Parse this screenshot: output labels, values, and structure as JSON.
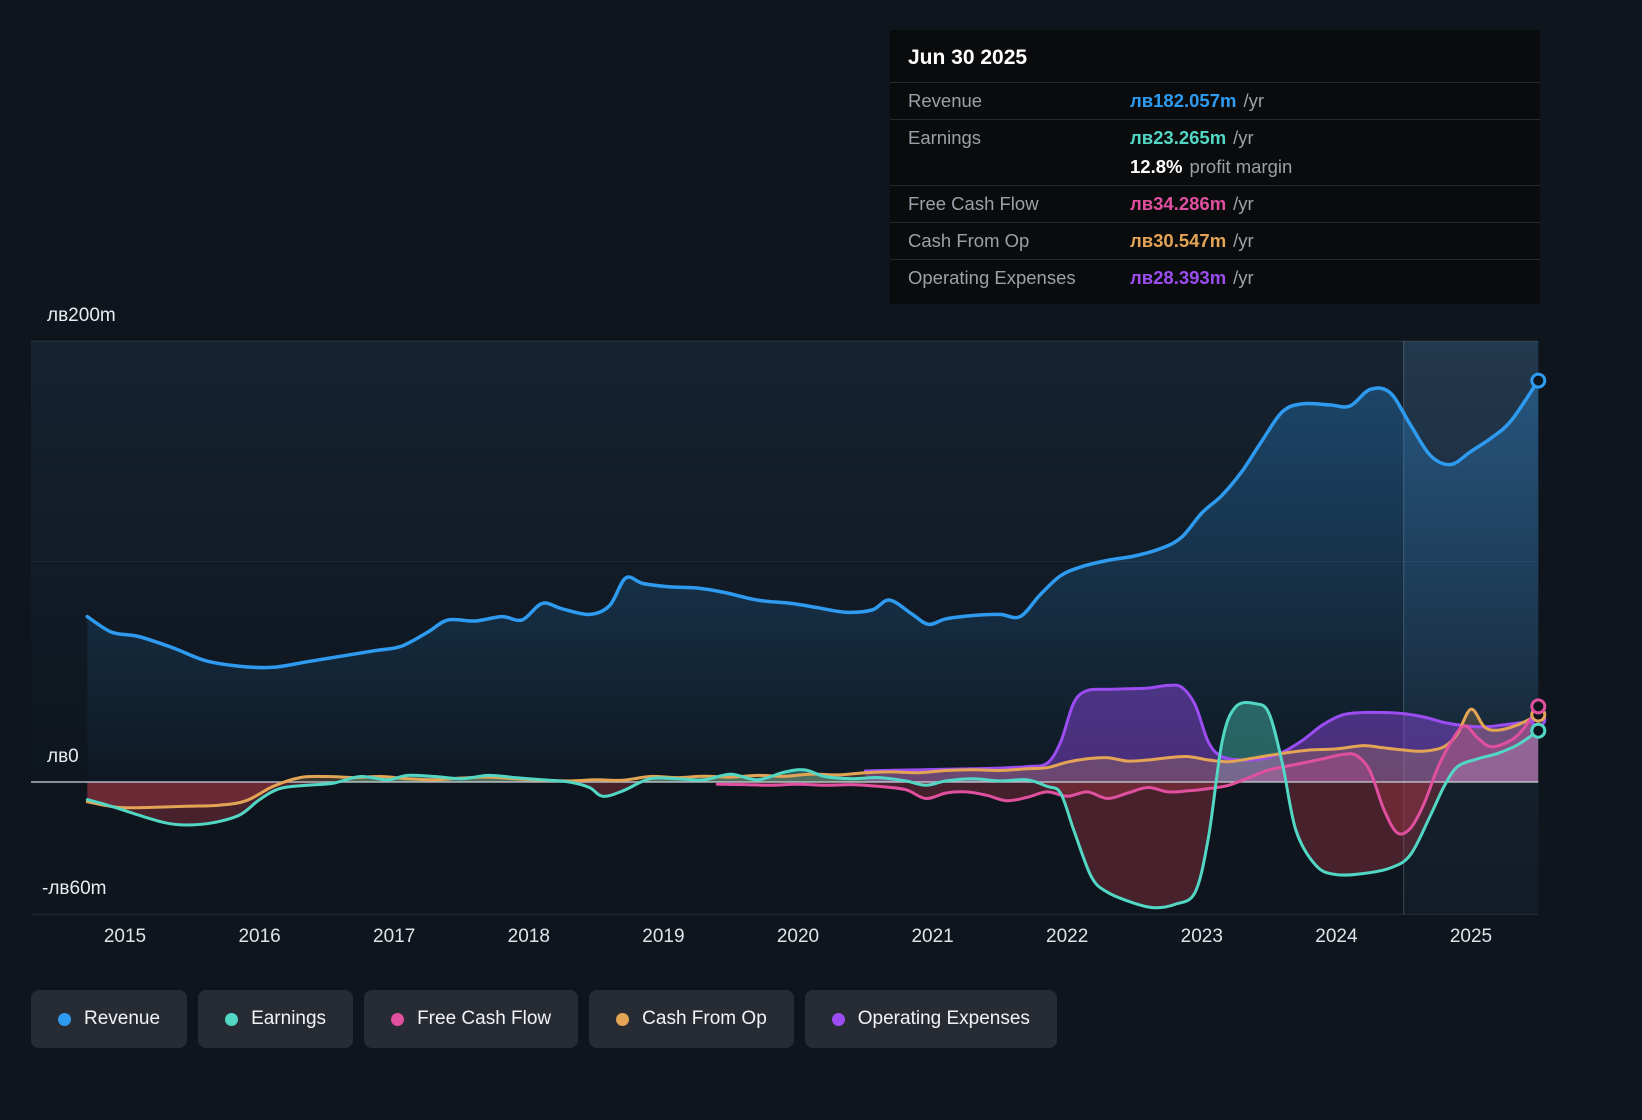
{
  "tooltip": {
    "date": "Jun 30 2025",
    "rows": [
      {
        "key": "revenue",
        "label": "Revenue",
        "value": "лв182.057m",
        "suffix": "/yr"
      },
      {
        "key": "earnings",
        "label": "Earnings",
        "value": "лв23.265m",
        "suffix": "/yr"
      },
      {
        "key": "fcf",
        "label": "Free Cash Flow",
        "value": "лв34.286m",
        "suffix": "/yr"
      },
      {
        "key": "cashop",
        "label": "Cash From Op",
        "value": "лв30.547m",
        "suffix": "/yr"
      },
      {
        "key": "opex",
        "label": "Operating Expenses",
        "value": "лв28.393m",
        "suffix": "/yr"
      }
    ],
    "margin": {
      "value": "12.8%",
      "suffix": "profit margin"
    }
  },
  "legend": {
    "items": [
      {
        "key": "revenue",
        "label": "Revenue"
      },
      {
        "key": "earnings",
        "label": "Earnings"
      },
      {
        "key": "fcf",
        "label": "Free Cash Flow"
      },
      {
        "key": "cashop",
        "label": "Cash From Op"
      },
      {
        "key": "opex",
        "label": "Operating Expenses"
      }
    ]
  },
  "chart_data": {
    "type": "line",
    "title": "",
    "currency_unit": "лв (millions)",
    "x_ticks": [
      "2015",
      "2016",
      "2017",
      "2018",
      "2019",
      "2020",
      "2021",
      "2022",
      "2023",
      "2024",
      "2025"
    ],
    "y_ticks": [
      {
        "label": "лв200m",
        "value": 200
      },
      {
        "label": "лв0",
        "value": 0
      },
      {
        "label": "-лв60m",
        "value": -60
      }
    ],
    "grid_values": [
      200,
      100,
      0,
      -60
    ],
    "xlim": [
      2014.55,
      2025.55
    ],
    "ylim": [
      -72,
      210
    ],
    "highlight_start_x": 2024.5,
    "negative_fill": "#c13a4e",
    "legend_position": "bottom",
    "series": [
      {
        "name": "Revenue",
        "key": "revenue",
        "color": "#2e9bf0",
        "points": [
          [
            2014.72,
            75
          ],
          [
            2014.9,
            68
          ],
          [
            2015.1,
            66
          ],
          [
            2015.35,
            61
          ],
          [
            2015.6,
            55
          ],
          [
            2015.85,
            52.5
          ],
          [
            2016.1,
            52
          ],
          [
            2016.35,
            54.5
          ],
          [
            2016.6,
            57
          ],
          [
            2016.85,
            59.5
          ],
          [
            2017.05,
            61.5
          ],
          [
            2017.25,
            68
          ],
          [
            2017.4,
            73.5
          ],
          [
            2017.6,
            73
          ],
          [
            2017.8,
            75
          ],
          [
            2017.95,
            73.5
          ],
          [
            2018.1,
            81
          ],
          [
            2018.25,
            78.5
          ],
          [
            2018.45,
            76
          ],
          [
            2018.6,
            80
          ],
          [
            2018.72,
            92.5
          ],
          [
            2018.85,
            90
          ],
          [
            2019.05,
            88.5
          ],
          [
            2019.25,
            88
          ],
          [
            2019.45,
            86
          ],
          [
            2019.7,
            82.5
          ],
          [
            2019.95,
            81
          ],
          [
            2020.15,
            79
          ],
          [
            2020.35,
            77
          ],
          [
            2020.55,
            78
          ],
          [
            2020.68,
            82.5
          ],
          [
            2020.85,
            76
          ],
          [
            2020.97,
            71.5
          ],
          [
            2021.1,
            74
          ],
          [
            2021.3,
            75.5
          ],
          [
            2021.5,
            76
          ],
          [
            2021.65,
            75
          ],
          [
            2021.8,
            85
          ],
          [
            2021.95,
            93.5
          ],
          [
            2022.1,
            97.5
          ],
          [
            2022.3,
            100.5
          ],
          [
            2022.5,
            102.5
          ],
          [
            2022.7,
            106
          ],
          [
            2022.85,
            111
          ],
          [
            2023.0,
            122
          ],
          [
            2023.15,
            130
          ],
          [
            2023.3,
            141
          ],
          [
            2023.45,
            155
          ],
          [
            2023.6,
            168
          ],
          [
            2023.75,
            171.5
          ],
          [
            2023.95,
            171
          ],
          [
            2024.1,
            170.5
          ],
          [
            2024.25,
            178
          ],
          [
            2024.4,
            176.5
          ],
          [
            2024.55,
            162
          ],
          [
            2024.7,
            148
          ],
          [
            2024.85,
            144
          ],
          [
            2025.0,
            150
          ],
          [
            2025.15,
            156
          ],
          [
            2025.3,
            164
          ],
          [
            2025.5,
            182.057
          ]
        ]
      },
      {
        "name": "Earnings",
        "key": "earnings",
        "color": "#52d7c5",
        "points": [
          [
            2014.72,
            -8
          ],
          [
            2014.9,
            -11
          ],
          [
            2015.1,
            -15
          ],
          [
            2015.3,
            -18.5
          ],
          [
            2015.45,
            -19.5
          ],
          [
            2015.65,
            -18.5
          ],
          [
            2015.85,
            -15
          ],
          [
            2016.0,
            -8
          ],
          [
            2016.15,
            -3
          ],
          [
            2016.35,
            -1.5
          ],
          [
            2016.55,
            -0.5
          ],
          [
            2016.75,
            2.5
          ],
          [
            2016.95,
            1
          ],
          [
            2017.1,
            3
          ],
          [
            2017.3,
            2.5
          ],
          [
            2017.5,
            1.5
          ],
          [
            2017.7,
            3
          ],
          [
            2017.9,
            2
          ],
          [
            2018.1,
            1
          ],
          [
            2018.3,
            0
          ],
          [
            2018.45,
            -2.5
          ],
          [
            2018.55,
            -6.5
          ],
          [
            2018.7,
            -4
          ],
          [
            2018.9,
            1.5
          ],
          [
            2019.1,
            1.5
          ],
          [
            2019.3,
            1
          ],
          [
            2019.5,
            3.5
          ],
          [
            2019.7,
            1
          ],
          [
            2019.9,
            4.5
          ],
          [
            2020.05,
            5.5
          ],
          [
            2020.2,
            2.5
          ],
          [
            2020.4,
            1.5
          ],
          [
            2020.6,
            2
          ],
          [
            2020.8,
            0.5
          ],
          [
            2020.95,
            -1.5
          ],
          [
            2021.1,
            0.5
          ],
          [
            2021.3,
            1.5
          ],
          [
            2021.5,
            0.5
          ],
          [
            2021.7,
            1
          ],
          [
            2021.85,
            -2
          ],
          [
            2021.95,
            -5
          ],
          [
            2022.05,
            -22
          ],
          [
            2022.18,
            -43
          ],
          [
            2022.3,
            -50
          ],
          [
            2022.5,
            -55
          ],
          [
            2022.65,
            -57
          ],
          [
            2022.8,
            -55.5
          ],
          [
            2022.95,
            -50
          ],
          [
            2023.05,
            -25
          ],
          [
            2023.15,
            18
          ],
          [
            2023.25,
            34
          ],
          [
            2023.4,
            35.5
          ],
          [
            2023.5,
            31
          ],
          [
            2023.6,
            8
          ],
          [
            2023.7,
            -22
          ],
          [
            2023.85,
            -38
          ],
          [
            2024.0,
            -42
          ],
          [
            2024.2,
            -41.5
          ],
          [
            2024.4,
            -39
          ],
          [
            2024.55,
            -33
          ],
          [
            2024.7,
            -15
          ],
          [
            2024.8,
            -2
          ],
          [
            2024.9,
            7
          ],
          [
            2025.05,
            10.5
          ],
          [
            2025.2,
            13
          ],
          [
            2025.35,
            17
          ],
          [
            2025.5,
            23.265
          ]
        ]
      },
      {
        "name": "Free Cash Flow",
        "key": "fcf",
        "color": "#e0509e",
        "points": [
          [
            2019.4,
            -1
          ],
          [
            2019.6,
            -1.2
          ],
          [
            2019.8,
            -1.5
          ],
          [
            2020.0,
            -1
          ],
          [
            2020.2,
            -1.5
          ],
          [
            2020.4,
            -1.2
          ],
          [
            2020.6,
            -2
          ],
          [
            2020.8,
            -3.5
          ],
          [
            2020.95,
            -7.5
          ],
          [
            2021.1,
            -5
          ],
          [
            2021.25,
            -4.5
          ],
          [
            2021.4,
            -6
          ],
          [
            2021.55,
            -8.5
          ],
          [
            2021.7,
            -7
          ],
          [
            2021.85,
            -4.5
          ],
          [
            2022.0,
            -6.5
          ],
          [
            2022.15,
            -4.5
          ],
          [
            2022.3,
            -7.5
          ],
          [
            2022.45,
            -5
          ],
          [
            2022.6,
            -2.5
          ],
          [
            2022.75,
            -4.5
          ],
          [
            2022.9,
            -4
          ],
          [
            2023.05,
            -3
          ],
          [
            2023.2,
            -1.5
          ],
          [
            2023.35,
            2
          ],
          [
            2023.5,
            5.5
          ],
          [
            2023.7,
            8
          ],
          [
            2023.9,
            10.5
          ],
          [
            2024.05,
            12.5
          ],
          [
            2024.15,
            12
          ],
          [
            2024.25,
            5
          ],
          [
            2024.35,
            -12
          ],
          [
            2024.45,
            -23
          ],
          [
            2024.55,
            -21
          ],
          [
            2024.65,
            -10
          ],
          [
            2024.75,
            6
          ],
          [
            2024.85,
            18
          ],
          [
            2024.95,
            25.5
          ],
          [
            2025.05,
            20
          ],
          [
            2025.15,
            16
          ],
          [
            2025.3,
            19
          ],
          [
            2025.4,
            25
          ],
          [
            2025.5,
            34.286
          ]
        ]
      },
      {
        "name": "Cash From Op",
        "key": "cashop",
        "color": "#e3a455",
        "points": [
          [
            2014.72,
            -9
          ],
          [
            2014.95,
            -11.5
          ],
          [
            2015.2,
            -11.5
          ],
          [
            2015.45,
            -11
          ],
          [
            2015.7,
            -10.5
          ],
          [
            2015.9,
            -8.5
          ],
          [
            2016.1,
            -2
          ],
          [
            2016.3,
            2
          ],
          [
            2016.5,
            2.5
          ],
          [
            2016.7,
            2
          ],
          [
            2016.9,
            2.5
          ],
          [
            2017.1,
            1.5
          ],
          [
            2017.3,
            1
          ],
          [
            2017.5,
            1.8
          ],
          [
            2017.7,
            2.2
          ],
          [
            2017.9,
            1.5
          ],
          [
            2018.1,
            0.8
          ],
          [
            2018.3,
            0.5
          ],
          [
            2018.5,
            1
          ],
          [
            2018.7,
            0.8
          ],
          [
            2018.9,
            2.5
          ],
          [
            2019.1,
            2
          ],
          [
            2019.3,
            2.6
          ],
          [
            2019.5,
            2.2
          ],
          [
            2019.7,
            3
          ],
          [
            2019.9,
            2.6
          ],
          [
            2020.1,
            3.6
          ],
          [
            2020.3,
            3.2
          ],
          [
            2020.5,
            4.2
          ],
          [
            2020.7,
            4.6
          ],
          [
            2020.9,
            4.2
          ],
          [
            2021.1,
            5.2
          ],
          [
            2021.3,
            5.6
          ],
          [
            2021.5,
            5.2
          ],
          [
            2021.7,
            6
          ],
          [
            2021.85,
            6.5
          ],
          [
            2022.0,
            9
          ],
          [
            2022.15,
            10.5
          ],
          [
            2022.3,
            11
          ],
          [
            2022.45,
            9.5
          ],
          [
            2022.6,
            10
          ],
          [
            2022.75,
            11
          ],
          [
            2022.9,
            11.5
          ],
          [
            2023.05,
            10
          ],
          [
            2023.2,
            9.2
          ],
          [
            2023.4,
            11
          ],
          [
            2023.6,
            13
          ],
          [
            2023.8,
            14.5
          ],
          [
            2024.0,
            15
          ],
          [
            2024.2,
            16.5
          ],
          [
            2024.35,
            15.5
          ],
          [
            2024.5,
            14.5
          ],
          [
            2024.65,
            14
          ],
          [
            2024.8,
            16
          ],
          [
            2024.9,
            22
          ],
          [
            2025.0,
            33
          ],
          [
            2025.1,
            25
          ],
          [
            2025.2,
            23.5
          ],
          [
            2025.35,
            26
          ],
          [
            2025.5,
            30.547
          ]
        ]
      },
      {
        "name": "Operating Expenses",
        "key": "opex",
        "color": "#9b4df2",
        "points": [
          [
            2020.5,
            5
          ],
          [
            2020.7,
            5.3
          ],
          [
            2020.9,
            5.5
          ],
          [
            2021.1,
            5.8
          ],
          [
            2021.3,
            6
          ],
          [
            2021.5,
            6.3
          ],
          [
            2021.7,
            7
          ],
          [
            2021.85,
            8.5
          ],
          [
            2021.95,
            18
          ],
          [
            2022.05,
            36
          ],
          [
            2022.15,
            41.5
          ],
          [
            2022.3,
            42
          ],
          [
            2022.45,
            42.3
          ],
          [
            2022.6,
            42.6
          ],
          [
            2022.75,
            43.8
          ],
          [
            2022.85,
            43
          ],
          [
            2022.95,
            35
          ],
          [
            2023.05,
            18
          ],
          [
            2023.15,
            11.5
          ],
          [
            2023.3,
            10
          ],
          [
            2023.45,
            10.5
          ],
          [
            2023.6,
            13.5
          ],
          [
            2023.75,
            19
          ],
          [
            2023.9,
            26
          ],
          [
            2024.05,
            30.5
          ],
          [
            2024.2,
            31.5
          ],
          [
            2024.35,
            31.5
          ],
          [
            2024.5,
            31
          ],
          [
            2024.65,
            29.5
          ],
          [
            2024.8,
            27
          ],
          [
            2024.95,
            25.5
          ],
          [
            2025.1,
            25
          ],
          [
            2025.25,
            26
          ],
          [
            2025.4,
            27.2
          ],
          [
            2025.5,
            28.393
          ]
        ]
      }
    ]
  }
}
